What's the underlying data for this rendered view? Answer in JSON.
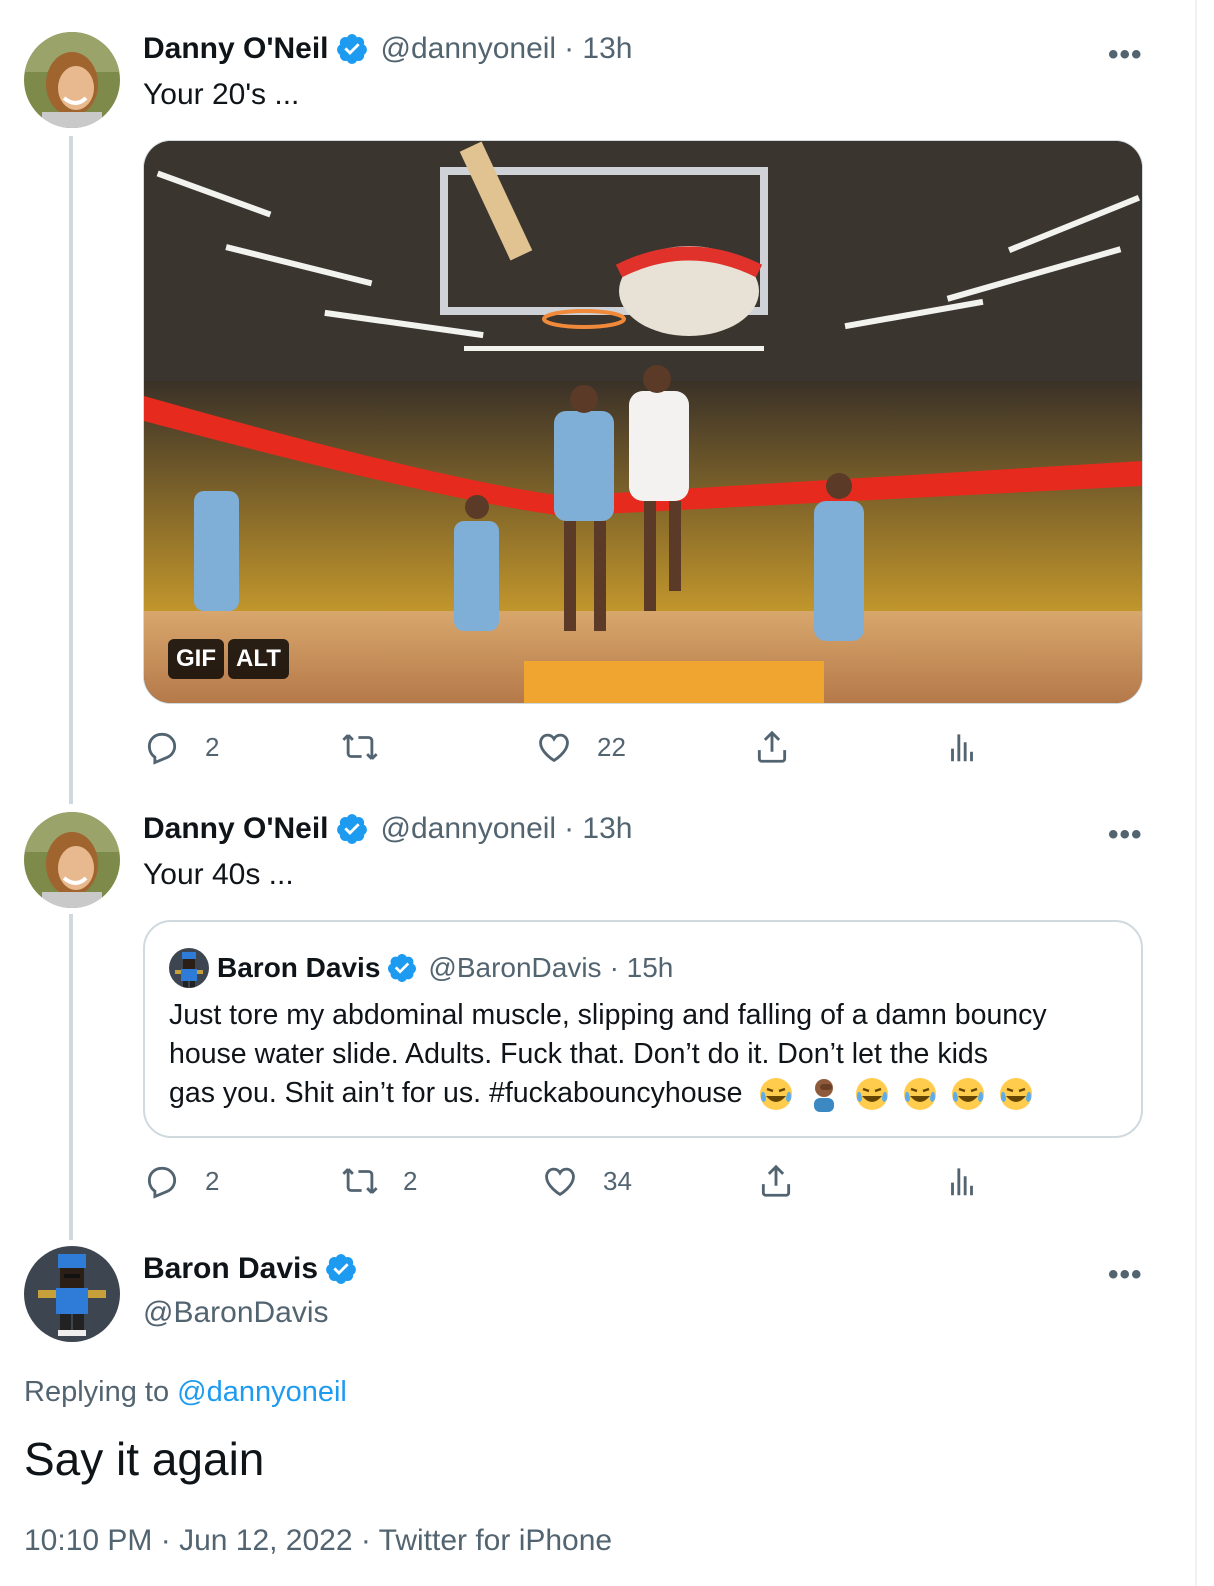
{
  "tweet1": {
    "name": "Danny O'Neil",
    "handle": "@dannyoneil",
    "time": "· 13h",
    "text": "Your 20's ...",
    "more": "•••",
    "media": {
      "gif_label": "GIF",
      "alt_label": "ALT"
    },
    "actions": {
      "replies": "2",
      "retweets": "",
      "likes": "22"
    }
  },
  "tweet2": {
    "name": "Danny O'Neil",
    "handle": "@dannyoneil",
    "time": "· 13h",
    "text": "Your 40s ...",
    "more": "•••",
    "actions": {
      "replies": "2",
      "retweets": "2",
      "likes": "34"
    },
    "quote": {
      "name": "Baron Davis",
      "handle": "@BaronDavis",
      "time": "· 15h",
      "line1": "Just tore my abdominal muscle, slipping and falling of a damn bouncy",
      "line2": "house water slide.  Adults.  Fuck that.  Don’t do it.  Don’t let the kids",
      "line3": "gas you.  Shit ain’t for us.  #fuckabouncyhouse"
    }
  },
  "main": {
    "name": "Baron Davis",
    "handle": "@BaronDavis",
    "more": "•••",
    "replying_prefix": "Replying to",
    "replying_handle": "@dannyoneil",
    "text": "Say it again",
    "meta": "10:10 PM · Jun 12, 2022 · Twitter for iPhone"
  },
  "colors": {
    "accent": "#1d9bf0",
    "muted": "#536471",
    "text": "#0f1419",
    "border": "#cfd9de"
  }
}
